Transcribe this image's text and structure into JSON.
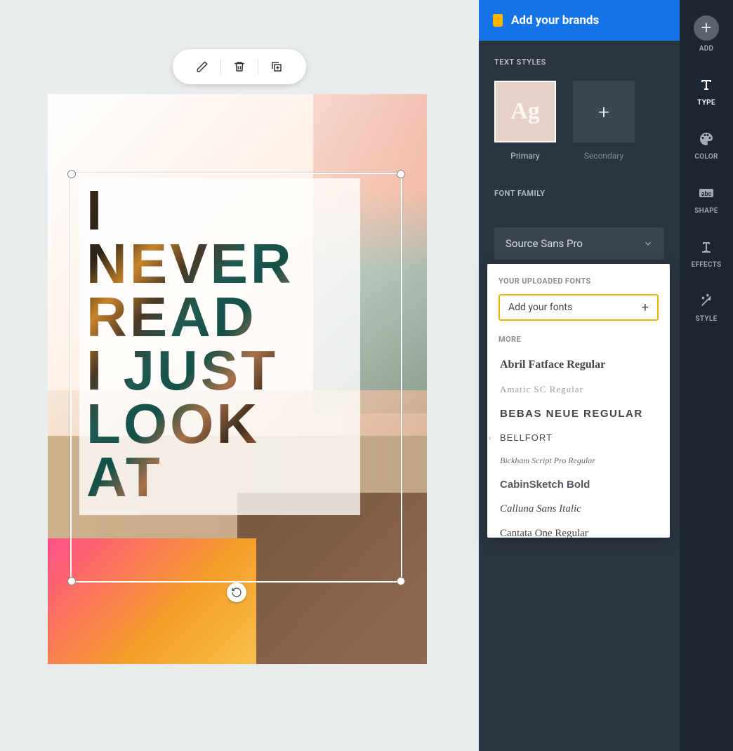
{
  "toolbar": {
    "edit": "edit",
    "delete": "delete",
    "duplicate": "duplicate"
  },
  "canvas": {
    "text": "I\nNEVER\nREAD\nI JUST\nLOOK\nAT"
  },
  "brandBanner": {
    "label": "Add your brands"
  },
  "textStyles": {
    "heading": "TEXT STYLES",
    "primary": {
      "swatch": "Ag",
      "label": "Primary"
    },
    "secondary": {
      "swatch": "+",
      "label": "Secondary"
    }
  },
  "fontFamily": {
    "heading": "FONT FAMILY",
    "selected": "Source Sans Pro"
  },
  "fontDropdown": {
    "uploadedHeading": "YOUR UPLOADED FONTS",
    "addFonts": "Add your fonts",
    "moreHeading": "MORE",
    "fonts": [
      "Abril Fatface Regular",
      "Amatic SC Regular",
      "BEBAS NEUE REGULAR",
      "BELLFORT",
      "Bickham Script Pro Regular",
      "CabinSketch Bold",
      "Calluna Sans Italic",
      "Cantata One Regular"
    ]
  },
  "rail": {
    "add": "ADD",
    "type": "TYPE",
    "color": "COLOR",
    "shape": "SHAPE",
    "effects": "EFFECTS",
    "style": "STYLE"
  }
}
